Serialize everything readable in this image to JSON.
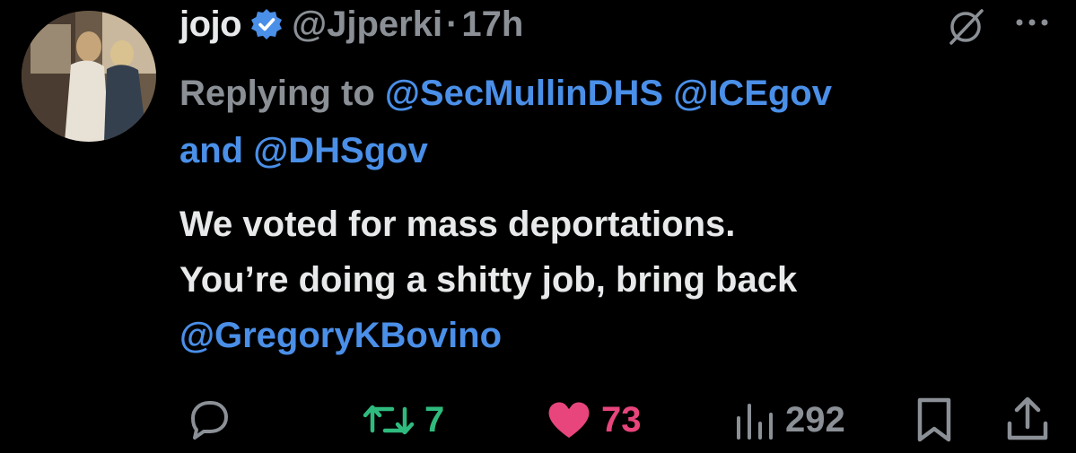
{
  "tweet": {
    "author": {
      "display_name": "jojo",
      "handle": "@Jjperki",
      "verified": true
    },
    "separator": "·",
    "time": "17h",
    "replying_prefix": "Replying to",
    "mentions": [
      "@SecMullinDHS",
      "@ICEgov"
    ],
    "mention_joiner": "and",
    "mention_last": "@DHSgov",
    "text_lines": [
      "We voted for mass deportations.",
      "You’re doing a shitty job, bring back"
    ],
    "text_mention": "@GregoryKBovino"
  },
  "actions": {
    "reply": {
      "icon": "reply-icon",
      "count": ""
    },
    "retweet": {
      "icon": "retweet-icon",
      "count": "7",
      "color": "#2fbb7e"
    },
    "like": {
      "icon": "heart-icon",
      "count": "73",
      "color": "#e8457c"
    },
    "views": {
      "icon": "views-icon",
      "count": "292"
    },
    "bookmark": {
      "icon": "bookmark-icon"
    },
    "share": {
      "icon": "share-icon"
    }
  },
  "colors": {
    "background": "#000000",
    "text": "#e7e9ea",
    "muted": "#8b9096",
    "link": "#4a8fe8"
  }
}
